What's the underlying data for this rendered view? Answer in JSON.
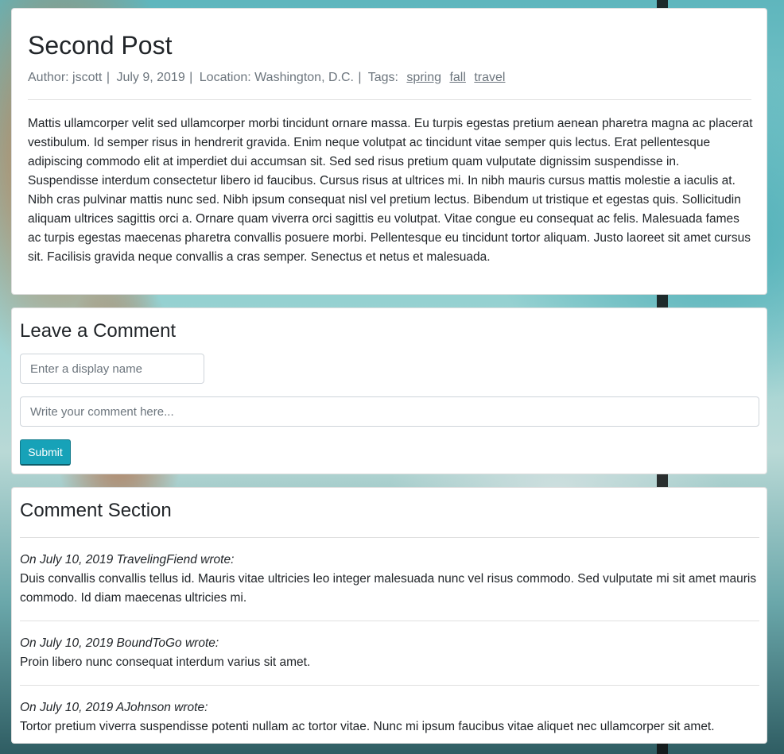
{
  "post": {
    "title": "Second Post",
    "author_label": "Author: jscott",
    "date": "July 9, 2019",
    "location_label": "Location: Washington, D.C.",
    "tags_label": "Tags:",
    "tags": [
      "spring",
      "fall",
      "travel"
    ],
    "body": "Mattis ullamcorper velit sed ullamcorper morbi tincidunt ornare massa. Eu turpis egestas pretium aenean pharetra magna ac placerat vestibulum. Id semper risus in hendrerit gravida. Enim neque volutpat ac tincidunt vitae semper quis lectus. Erat pellentesque adipiscing commodo elit at imperdiet dui accumsan sit. Sed sed risus pretium quam vulputate dignissim suspendisse in. Suspendisse interdum consectetur libero id faucibus. Cursus risus at ultrices mi. In nibh mauris cursus mattis molestie a iaculis at. Nibh cras pulvinar mattis nunc sed. Nibh ipsum consequat nisl vel pretium lectus. Bibendum ut tristique et egestas quis. Sollicitudin aliquam ultrices sagittis orci a. Ornare quam viverra orci sagittis eu volutpat. Vitae congue eu consequat ac felis. Malesuada fames ac turpis egestas maecenas pharetra convallis posuere morbi. Pellentesque eu tincidunt tortor aliquam. Justo laoreet sit amet cursus sit. Facilisis gravida neque convallis a cras semper. Senectus et netus et malesuada."
  },
  "comment_form": {
    "title": "Leave a Comment",
    "name_placeholder": "Enter a display name",
    "comment_placeholder": "Write your comment here...",
    "submit_label": "Submit"
  },
  "comments_section": {
    "title": "Comment Section",
    "comments": [
      {
        "header": "On July 10, 2019 TravelingFiend wrote:",
        "text": "Duis convallis convallis tellus id. Mauris vitae ultricies leo integer malesuada nunc vel risus commodo. Sed vulputate mi sit amet mauris commodo. Id diam maecenas ultricies mi."
      },
      {
        "header": "On July 10, 2019 BoundToGo wrote:",
        "text": "Proin libero nunc consequat interdum varius sit amet."
      },
      {
        "header": "On July 10, 2019 AJohnson wrote:",
        "text": "Tortor pretium viverra suspendisse potenti nullam ac tortor vitae. Nunc mi ipsum faucibus vitae aliquet nec ullamcorper sit amet."
      }
    ]
  },
  "colors": {
    "submit_button": "#17a2b8",
    "meta_text": "#6c757d"
  }
}
